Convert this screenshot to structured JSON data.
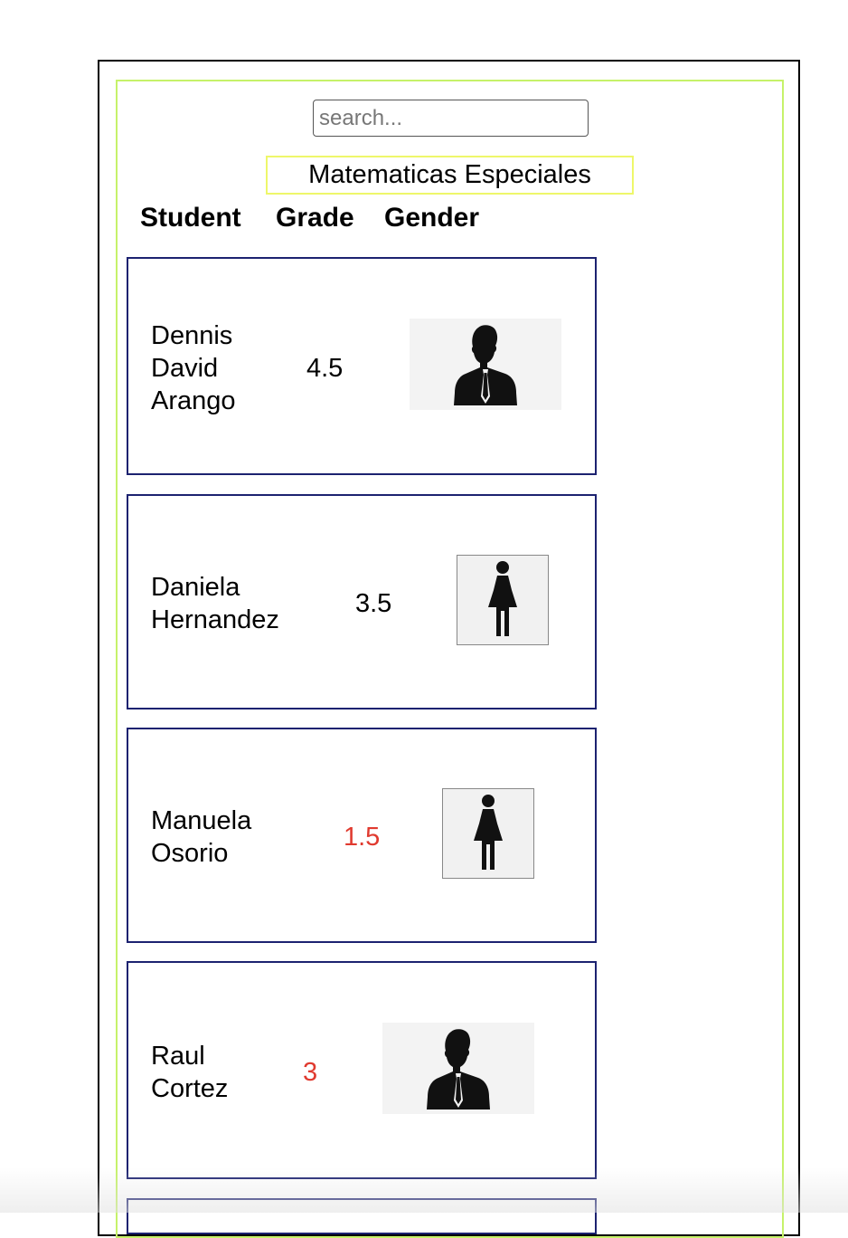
{
  "search": {
    "placeholder": "search..."
  },
  "course": {
    "title": "Matematicas Especiales"
  },
  "headers": {
    "student": "Student",
    "grade": "Grade",
    "gender": "Gender"
  },
  "colors": {
    "failing_grade": "#e03a2f",
    "passing_grade": "#000000",
    "card_border": "#1c2270",
    "course_border": "#eef76a",
    "inner_border": "#c6f26a"
  },
  "students": [
    {
      "name_lines": [
        "Dennis",
        "David",
        "Arango"
      ],
      "grade": "4.5",
      "grade_status": "passing",
      "gender_icon": "male-silhouette-icon"
    },
    {
      "name_lines": [
        "Daniela",
        "Hernandez"
      ],
      "grade": "3.5",
      "grade_status": "passing",
      "gender_icon": "female-silhouette-icon"
    },
    {
      "name_lines": [
        "Manuela",
        "Osorio"
      ],
      "grade": "1.5",
      "grade_status": "failing",
      "gender_icon": "female-silhouette-icon"
    },
    {
      "name_lines": [
        "Raul",
        "Cortez"
      ],
      "grade": "3",
      "grade_status": "failing",
      "gender_icon": "male-silhouette-icon"
    }
  ]
}
